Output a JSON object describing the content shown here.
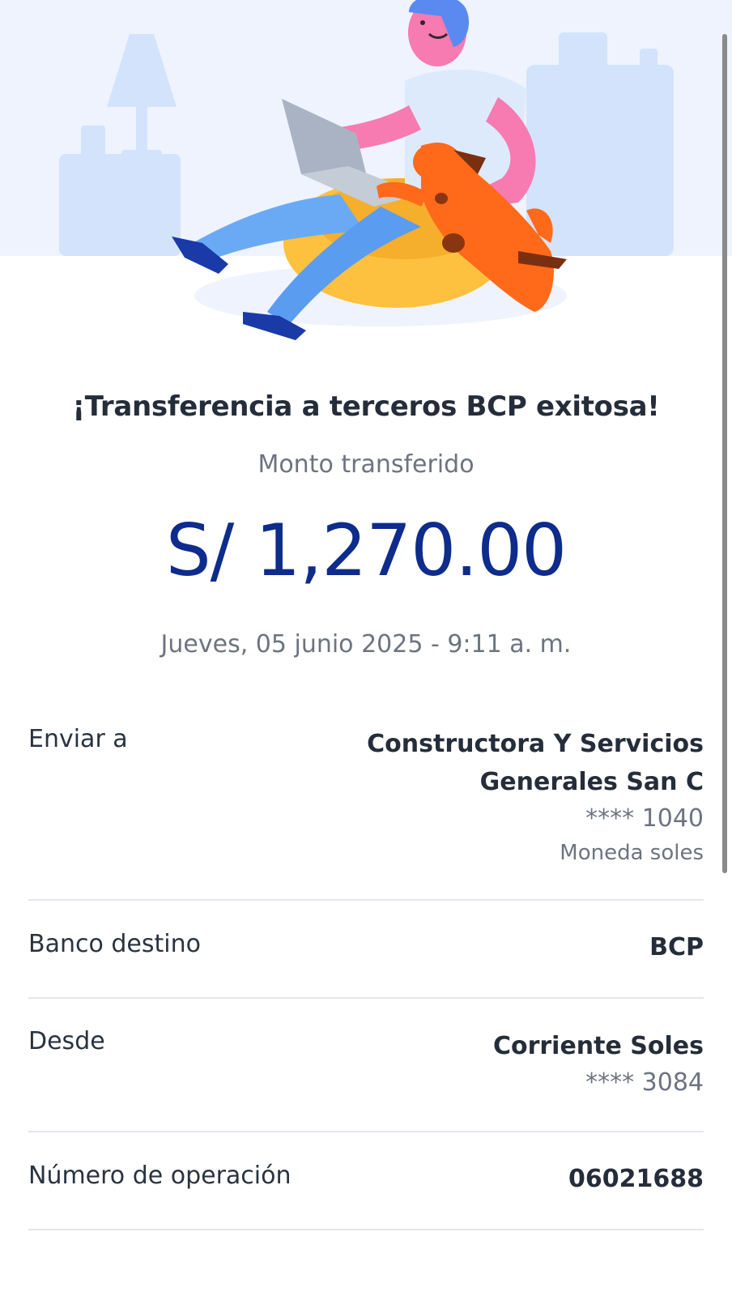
{
  "receipt": {
    "title": "¡Transferencia a terceros BCP exitosa!",
    "amount_label": "Monto transferido",
    "amount": "S/ 1,270.00",
    "datetime": "Jueves, 05 junio 2025 - 9:11 a. m."
  },
  "details": {
    "recipient": {
      "label": "Enviar a",
      "name_line1": "Constructora Y Servicios",
      "name_line2": "Generales San C",
      "account": "**** 1040",
      "currency": "Moneda soles"
    },
    "bank": {
      "label": "Banco destino",
      "value": "BCP"
    },
    "from": {
      "label": "Desde",
      "account_type": "Corriente Soles",
      "account": "**** 3084"
    },
    "operation": {
      "label": "Número de operación",
      "value": "06021688"
    }
  },
  "colors": {
    "amount": "#0d2c8c",
    "hero_bg": "#eef3fd",
    "divider": "#e4e6ea"
  }
}
